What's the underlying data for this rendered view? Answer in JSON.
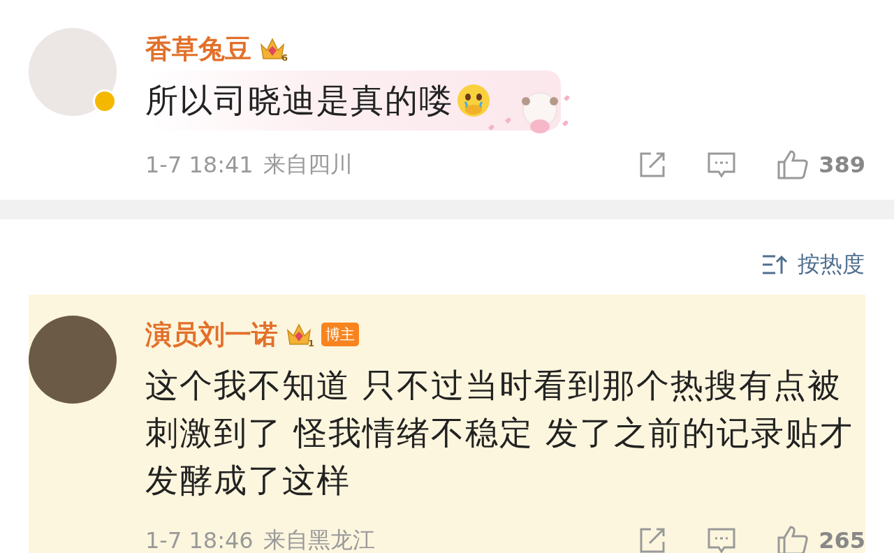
{
  "comments": [
    {
      "name": "香草兔豆",
      "level": "6",
      "verified": true,
      "sticker": true,
      "text": "所以司晓迪是真的喽",
      "emoji": true,
      "time": "1-7 18:41",
      "location": "来自四川",
      "likes": "389"
    },
    {
      "name": "演员刘一诺",
      "level": "1",
      "role": "博主",
      "highlighted": true,
      "text": "这个我不知道 只不过当时看到那个热搜有点被刺激到了 怪我情绪不稳定 发了之前的记录贴才发酵成了这样",
      "time": "1-7 18:46",
      "location": "来自黑龙江",
      "likes": "265"
    }
  ],
  "sort": {
    "label": "按热度"
  }
}
